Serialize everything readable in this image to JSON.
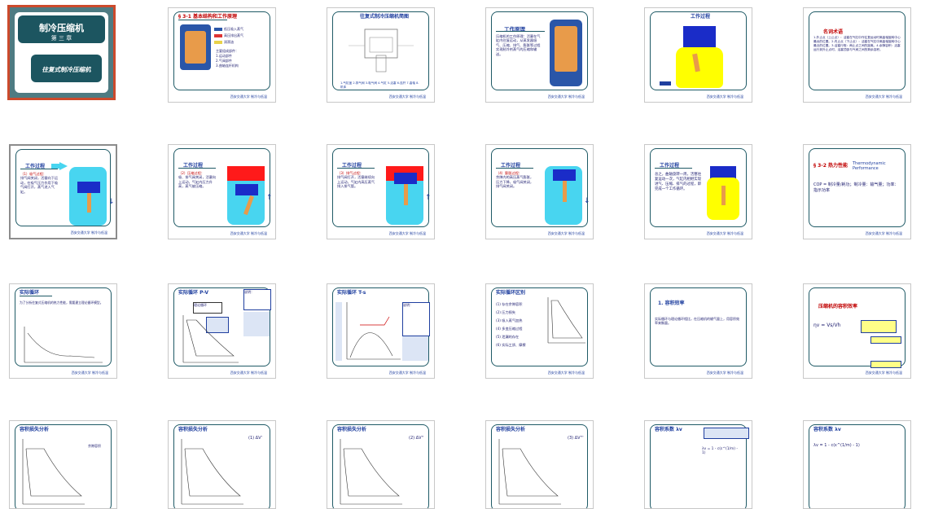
{
  "slides": [
    {
      "id": 1,
      "t": "制冷压缩机",
      "t2": "第 三 章",
      "sub": "往复式制冷压缩机"
    },
    {
      "id": 2,
      "t": "§ 3-1 基本结构和工作原理",
      "legend": [
        "低压吸入蒸气",
        "高压排出蒸气",
        "润滑油"
      ],
      "items": [
        "主要组成部件：",
        "1.运动部件",
        "2.气阀部件",
        "3.曲轴连杆机构"
      ],
      "foot": "西安交通大学 制冷与低温"
    },
    {
      "id": 3,
      "t": "往复式制冷压缩机简图",
      "legend": "1.气缸盖 2.排气阀 3.吸气阀 4.气缸 5.活塞 6.连杆 7.曲轴 8.机体",
      "foot": "西安交通大学 制冷与低温"
    },
    {
      "id": 4,
      "t": "工作原理",
      "text": "压缩机的工作原理：活塞在气缸内往复运动，从蒸发器吸气、压缩、排气、膨胀等过程实现制冷剂蒸气的压缩和输送。",
      "foot": "西安交通大学 制冷与低温"
    },
    {
      "id": 5,
      "t": "工作过程",
      "foot": "西安交通大学 制冷与低温"
    },
    {
      "id": 6,
      "t": "名词术语",
      "text": "1.外止点（上止点）：活塞在气缸中作往复运动时离曲轴旋转中心最远的位置。2.内止点（下止点）：活塞在气缸中离曲轴旋转中心最近的位置。3.活塞行程：两止点之间的距离。4.余隙容积：活塞运行到外止点时，活塞顶部与气阀之间的剩余容积。",
      "foot": "西安交通大学 制冷与低温"
    },
    {
      "id": 7,
      "t": "工作过程",
      "head": "（1）吸气过程：",
      "text": "排气阀关闭，活塞向下运动，在吸气压力作用下吸气阀打开，蒸气进入气缸。",
      "foot": "西安交通大学 制冷与低温"
    },
    {
      "id": 8,
      "t": "工作过程",
      "head": "（2）压缩过程：",
      "text": "吸、排气阀关闭，活塞向上运动，气缸内压力升高，蒸气被压缩。",
      "foot": "西安交通大学 制冷与低温"
    },
    {
      "id": 9,
      "t": "工作过程",
      "head": "（3）排气过程：",
      "text": "排气阀打开，活塞继续向上运动，气缸内高压蒸气排入排气管。",
      "foot": "西安交通大学 制冷与低温"
    },
    {
      "id": 10,
      "t": "工作过程",
      "head": "（4）膨胀过程：",
      "text": "余隙内的高压蒸气膨胀，压力下降，吸气阀关闭，排气阀关闭。",
      "foot": "西安交通大学 制冷与低温"
    },
    {
      "id": 11,
      "t": "工作过程",
      "text": "总之，曲轴旋转一周，活塞往复运动一次，气缸内相继实现进气、压缩、排气的过程，即完成一个工作循环。",
      "foot": "西安交通大学 制冷与低温"
    },
    {
      "id": 12,
      "t": "§ 3-2 热力性能",
      "t_en": "Thermodynamic Performance",
      "text": "COP = 制冷量/耗功；制冷量：输气量；功率：指示功率",
      "foot": "西安交通大学 制冷与低温"
    },
    {
      "id": 13,
      "t": "实际循环",
      "text": "为了分析往复式压缩机的热力性能，需要建立理论循环模型。",
      "foot": "西安交通大学 制冷与低温"
    },
    {
      "id": 14,
      "t": "实际循环 P-V",
      "box": "理论循环",
      "text": "说明：",
      "foot": "西安交通大学 制冷与低温"
    },
    {
      "id": 15,
      "t": "实际循环 T-s",
      "text": "说明：",
      "foot": "西安交通大学 制冷与低温"
    },
    {
      "id": 16,
      "t": "实际循环区别",
      "items": [
        "(1) 存在余隙容积",
        "(2) 压力损失",
        "(3) 吸入蒸气加热",
        "(4) 多变压缩过程",
        "(5) 泄漏的存在",
        "(6) 实际工质、摩擦"
      ],
      "foot": "西安交通大学 制冷与低温"
    },
    {
      "id": 17,
      "t": "1. 容积效率",
      "text": "实际循环与理论循环相比，在压缩机的输气量上，用容积效率来衡量。",
      "foot": "西安交通大学 制冷与低温"
    },
    {
      "id": 18,
      "t": "压缩机的容积效率",
      "text": "ηv = Vs/Vh",
      "foot": "西安交通大学 制冷与低温"
    },
    {
      "id": 19,
      "t": "容积损失分析",
      "text": "余隙容积",
      "foot": "西安交通大学 制冷与低温"
    },
    {
      "id": 20,
      "t": "容积损失分析",
      "text": "(1) ΔV'",
      "foot": "西安交通大学 制冷与低温"
    },
    {
      "id": 21,
      "t": "容积损失分析",
      "text": "(2) ΔV''",
      "foot": "西安交通大学 制冷与低温"
    },
    {
      "id": 22,
      "t": "容积损失分析",
      "text": "(3) ΔV'''",
      "foot": "西安交通大学 制冷与低温"
    },
    {
      "id": 23,
      "t": "容积系数 λv",
      "text": "λv = 1 - c(ε^(1/m) - 1)",
      "foot": "西安交通大学 制冷与低温"
    },
    {
      "id": 24,
      "t": "容积系数 λv",
      "text": "λv = 1 - c(ε^(1/m) - 1)",
      "foot": "西安交通大学 制冷与低温"
    }
  ],
  "colors": {
    "accent": "#cc4a2c",
    "dark": "#1c5560",
    "blue": "#1f3f9f",
    "red": "#c00000"
  }
}
